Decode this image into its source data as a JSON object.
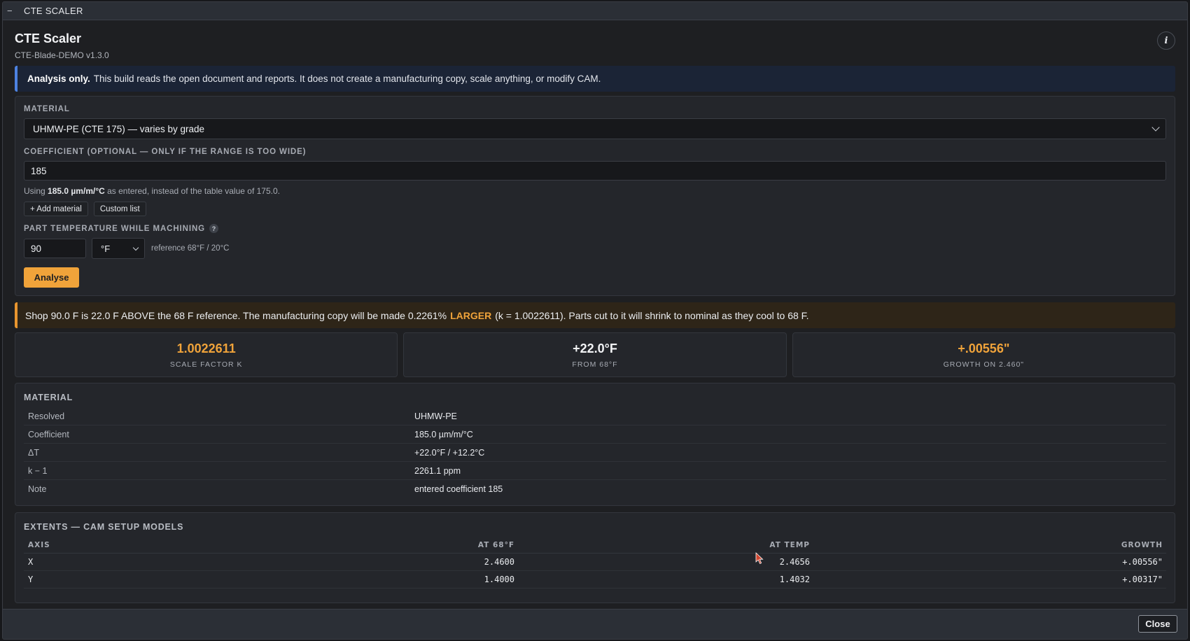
{
  "window": {
    "title": "CTE SCALER",
    "collapse_icon": "−"
  },
  "header": {
    "title": "CTE Scaler",
    "version": "CTE-Blade-DEMO v1.3.0",
    "info_label": "i"
  },
  "notice": {
    "bold": "Analysis only.",
    "text": "This build reads the open document and reports. It does not create a manufacturing copy, scale anything, or modify CAM."
  },
  "form": {
    "material_label": "MATERIAL",
    "material_value": "UHMW-PE (CTE 175) — varies by grade",
    "coefficient_label": "COEFFICIENT (OPTIONAL — ONLY IF THE RANGE IS TOO WIDE)",
    "coefficient_value": "185",
    "hint_prefix": "Using",
    "hint_bold": "185.0 µm/m/°C",
    "hint_suffix": "as entered, instead of the table value of 175.0.",
    "add_material_label": "+ Add material",
    "custom_list_label": "Custom list",
    "temp_label": "PART TEMPERATURE WHILE MACHINING",
    "temp_help": "?",
    "temp_value": "90",
    "unit_value": "°F",
    "reference_text": "reference 68°F / 20°C",
    "analyse_label": "Analyse"
  },
  "result": {
    "text_before": "Shop 90.0 F is 22.0 F ABOVE the 68 F reference. The manufacturing copy will be made 0.2261%",
    "highlight": "LARGER",
    "text_after": "(k = 1.0022611). Parts cut to it will shrink to nominal as they cool to 68 F.",
    "accent_color": "#f0a33a"
  },
  "stats": [
    {
      "value": "1.0022611",
      "label": "SCALE FACTOR K"
    },
    {
      "value": "+22.0°F",
      "label": "FROM 68°F"
    },
    {
      "value": "+.00556\"",
      "label": "GROWTH ON 2.460\""
    }
  ],
  "material_section": {
    "title": "MATERIAL",
    "rows": [
      {
        "key": "Resolved",
        "value": "UHMW-PE"
      },
      {
        "key": "Coefficient",
        "value": "185.0 µm/m/°C"
      },
      {
        "key": "ΔT",
        "value": "+22.0°F / +12.2°C"
      },
      {
        "key": "k − 1",
        "value": "2261.1 ppm"
      },
      {
        "key": "Note",
        "value": "entered coefficient 185"
      }
    ]
  },
  "extents": {
    "title": "EXTENTS — CAM SETUP MODELS",
    "columns": [
      "AXIS",
      "AT 68°F",
      "AT TEMP",
      "GROWTH"
    ],
    "rows": [
      [
        "X",
        "2.4600",
        "2.4656",
        "+.00556\""
      ],
      [
        "Y",
        "1.4000",
        "1.4032",
        "+.00317\""
      ]
    ]
  },
  "footer": {
    "close_label": "Close"
  }
}
